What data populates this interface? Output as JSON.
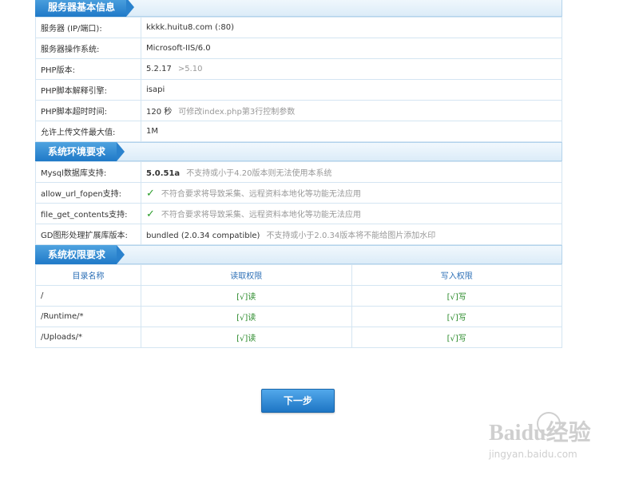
{
  "sections": {
    "basic": {
      "title": "服务器基本信息",
      "rows": [
        {
          "label": "服务器 (IP/端口):",
          "value": "kkkk.huitu8.com (:80)",
          "note": ""
        },
        {
          "label": "服务器操作系统:",
          "value": "Microsoft-IIS/6.0",
          "note": ""
        },
        {
          "label": "PHP版本:",
          "value": "5.2.17",
          "note": ">5.10"
        },
        {
          "label": "PHP脚本解释引擎:",
          "value": "isapi",
          "note": ""
        },
        {
          "label": "PHP脚本超时时间:",
          "value": "120 秒",
          "note": "可修改index.php第3行控制参数"
        },
        {
          "label": "允许上传文件最大值:",
          "value": "1M",
          "note": ""
        }
      ]
    },
    "env": {
      "title": "系统环境要求",
      "rows": [
        {
          "label": "Mysql数据库支持:",
          "value": "5.0.51a",
          "note": "不支持或小于4.20版本则无法使用本系统"
        },
        {
          "label": "allow_url_fopen支持:",
          "value": "✓",
          "note": "不符合要求将导致采集、远程资料本地化等功能无法应用"
        },
        {
          "label": "file_get_contents支持:",
          "value": "✓",
          "note": "不符合要求将导致采集、远程资料本地化等功能无法应用"
        },
        {
          "label": "GD图形处理扩展库版本:",
          "value": "bundled (2.0.34 compatible)",
          "note": "不支持或小于2.0.34版本将不能给图片添加水印"
        }
      ]
    },
    "perm": {
      "title": "系统权限要求",
      "headers": [
        "目录名称",
        "读取权限",
        "写入权限"
      ],
      "rows": [
        {
          "dir": "/",
          "read": "[√]读",
          "write": "[√]写"
        },
        {
          "dir": "/Runtime/*",
          "read": "[√]读",
          "write": "[√]写"
        },
        {
          "dir": "/Uploads/*",
          "read": "[√]读",
          "write": "[√]写"
        }
      ]
    }
  },
  "next_button": "下一步",
  "watermark": {
    "logo": "Baidu经验",
    "url": "jingyan.baidu.com"
  },
  "colors": {
    "accent": "#2a82cd",
    "ok": "#2a9d2a",
    "border": "#d4e5f2"
  }
}
